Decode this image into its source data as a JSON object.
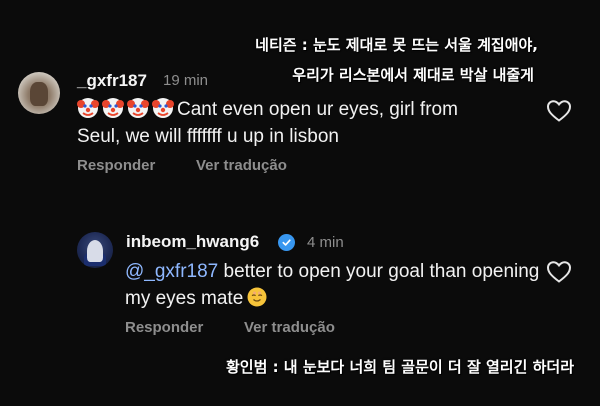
{
  "captions": {
    "netizen_line1": "네티즌 : 눈도 제대로 못 뜨는 서울 계집애야,",
    "netizen_line2": "우리가 리스본에서 제대로 박살 내줄게",
    "hwang_reply": "황인범 : 내 눈보다 너희 팀 골문이 더 잘 열리긴 하더라"
  },
  "comments": [
    {
      "username": "_gxfr187",
      "time": "19 min",
      "avatar": "user-avatar",
      "emojis": [
        "clown-face",
        "clown-face",
        "clown-face",
        "clown-face"
      ],
      "text": "Cant even open ur eyes, girl from Seul, we will fffffff u up in lisbon",
      "reply_label": "Responder",
      "translate_label": "Ver tradução"
    },
    {
      "username": "inbeom_hwang6",
      "verified": true,
      "time": "4 min",
      "mention": "@_gxfr187",
      "text": "better to open your goal than opening my eyes mate",
      "emoji": "relieved-smile",
      "reply_label": "Responder",
      "translate_label": "Ver tradução"
    }
  ],
  "colors": {
    "background": "#0b0b0b",
    "secondary_text": "#8e8e8e",
    "mention": "#8fb8ff",
    "verified": "#3897f0"
  }
}
